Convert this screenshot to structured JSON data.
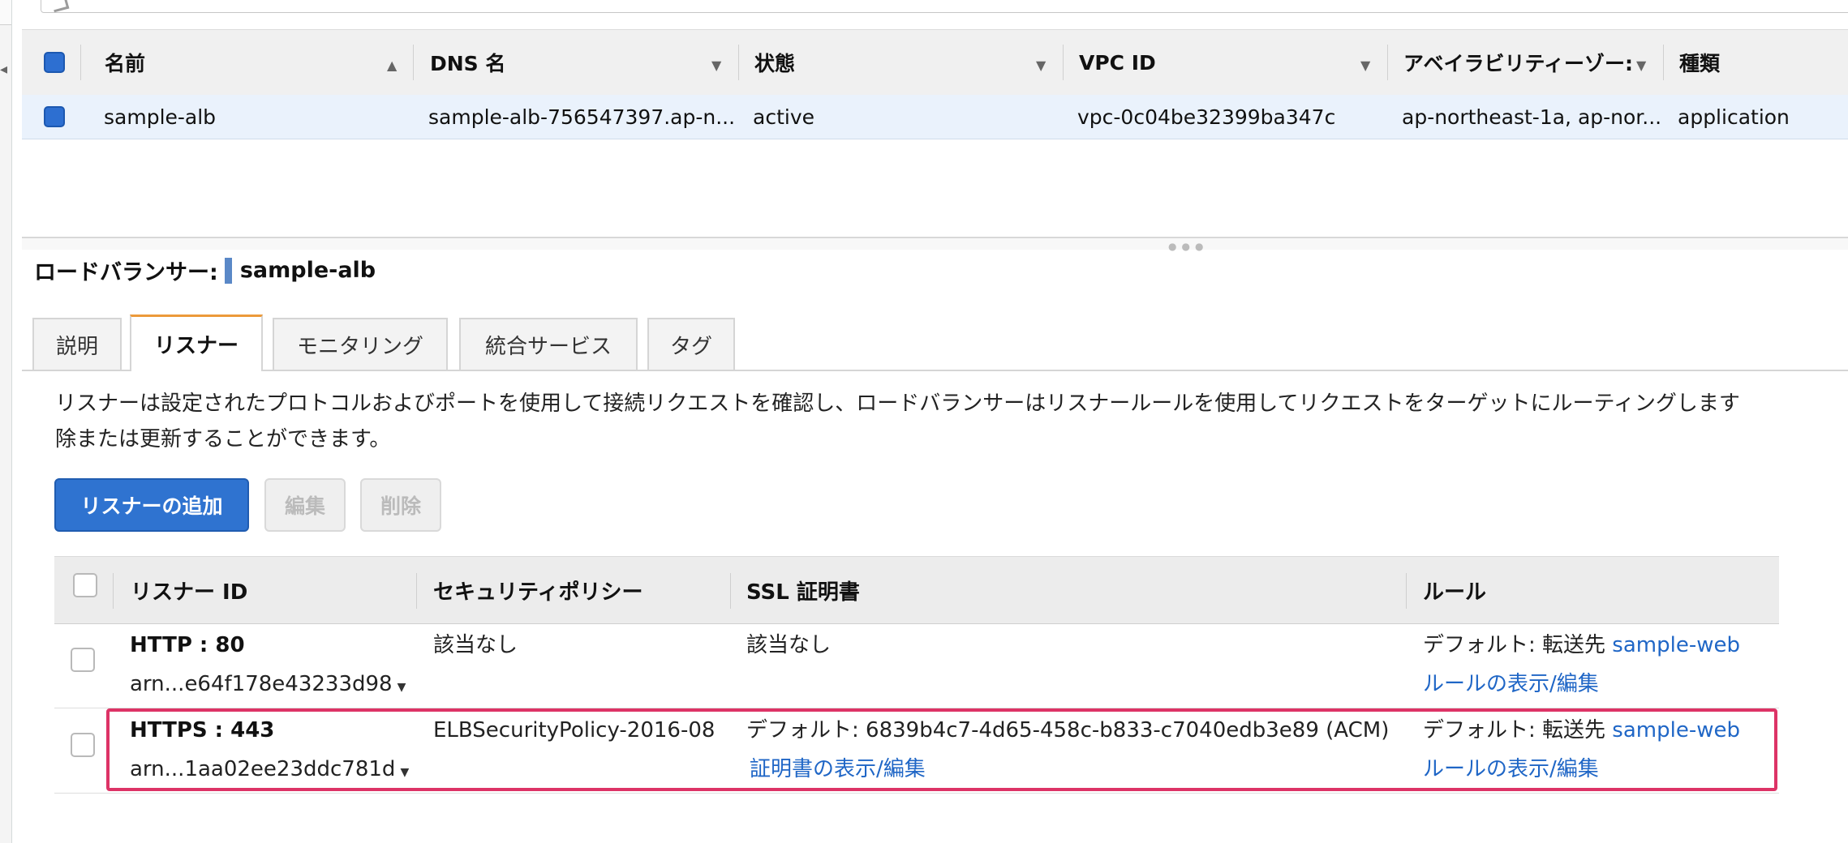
{
  "top_table": {
    "columns": [
      {
        "label": "名前",
        "sort": "▲"
      },
      {
        "label": "DNS 名",
        "sort": "▼"
      },
      {
        "label": "状態",
        "sort": "▼"
      },
      {
        "label": "VPC ID",
        "sort": "▼"
      },
      {
        "label": "アベイラビリティーゾー:",
        "sort": "▼"
      },
      {
        "label": "種類",
        "sort": ""
      }
    ],
    "rows": [
      {
        "name": "sample-alb",
        "dns": "sample-alb-756547397.ap-n...",
        "state": "active",
        "vpc": "vpc-0c04be32399ba347c",
        "az": "ap-northeast-1a, ap-nor...",
        "type": "application"
      }
    ]
  },
  "details": {
    "title_label": "ロードバランサー:",
    "title_value": "sample-alb"
  },
  "tabs": [
    "説明",
    "リスナー",
    "モニタリング",
    "統合サービス",
    "タグ"
  ],
  "active_tab": "リスナー",
  "description": {
    "line1": "リスナーは設定されたプロトコルおよびポートを使用して接続リクエストを確認し、ロードバランサーはリスナールールを使用してリクエストをターゲットにルーティングします",
    "line2": "除または更新することができます。"
  },
  "actions": {
    "add_listener": "リスナーの追加",
    "edit": "編集",
    "delete": "削除"
  },
  "listener_table": {
    "columns": [
      "リスナー ID",
      "セキュリティポリシー",
      "SSL 証明書",
      "ルール"
    ],
    "rows": [
      {
        "protocol": "HTTP : 80",
        "arn": "arn...e64f178e43233d98",
        "policy": "該当なし",
        "cert": "該当なし",
        "cert_link": "",
        "rule_prefix": "デフォルト: 転送先",
        "rule_target": "sample-web",
        "rule_link": "ルールの表示/編集"
      },
      {
        "protocol": "HTTPS : 443",
        "arn": "arn...1aa02ee23ddc781d",
        "policy": "ELBSecurityPolicy-2016-08",
        "cert": "デフォルト: 6839b4c7-4d65-458c-b833-c7040edb3e89 (ACM)",
        "cert_link": "証明書の表示/編集",
        "rule_prefix": "デフォルト: 転送先",
        "rule_target": "sample-web",
        "rule_link": "ルールの表示/編集"
      }
    ]
  },
  "colors": {
    "primary": "#2f73d0",
    "active_tab_accent": "#ec9a3a",
    "selected_row": "#eaf2fc",
    "link": "#1f66c6",
    "highlight": "#dd3366"
  }
}
